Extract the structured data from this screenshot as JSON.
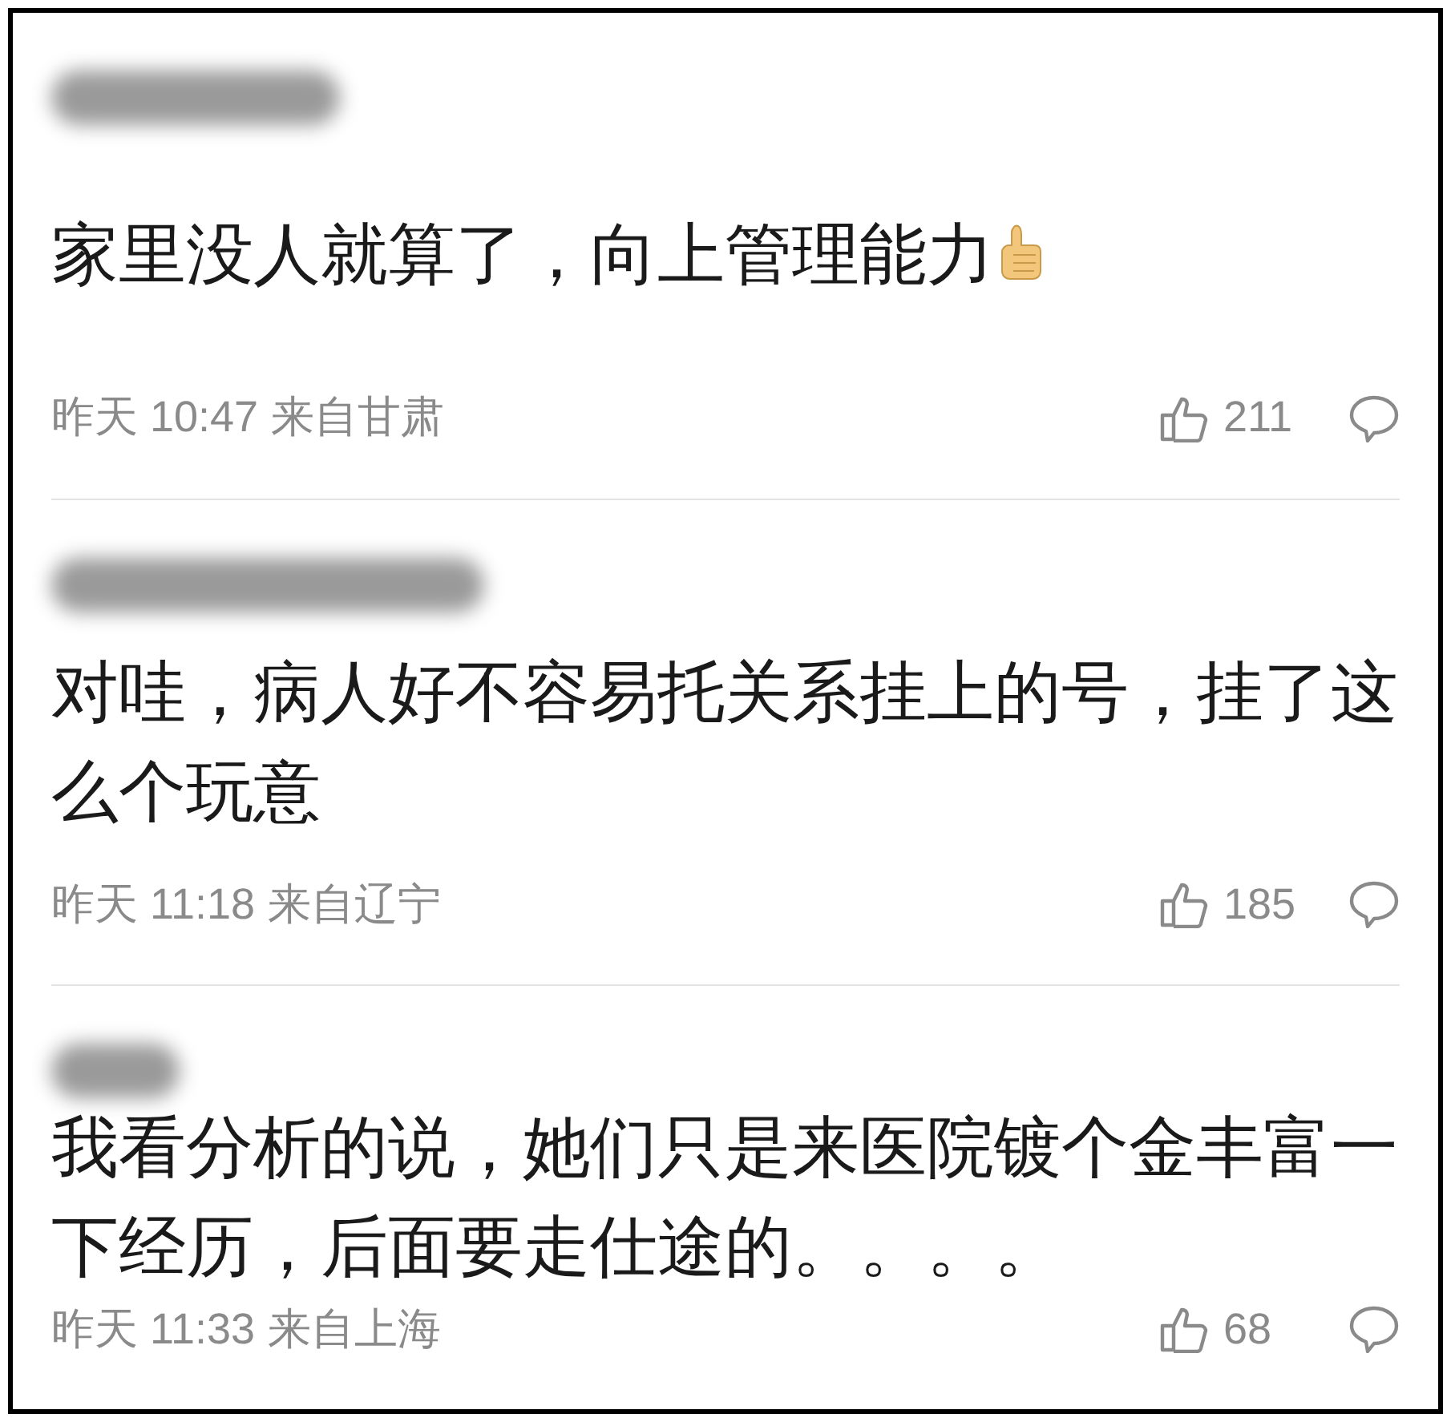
{
  "comments": [
    {
      "text": "家里没人就算了，向上管理能力",
      "thumb_emoji": true,
      "time": "昨天 10:47",
      "location": "来自甘肃",
      "likes": "211"
    },
    {
      "text": "对哇，病人好不容易托关系挂上的号，挂了这么个玩意",
      "thumb_emoji": false,
      "time": "昨天 11:18",
      "location": "来自辽宁",
      "likes": "185"
    },
    {
      "text": "我看分析的说，她们只是来医院镀个金丰富一下经历，后面要走仕途的。。。。",
      "thumb_emoji": false,
      "time": "昨天 11:33",
      "location": "来自上海",
      "likes": "68"
    }
  ]
}
